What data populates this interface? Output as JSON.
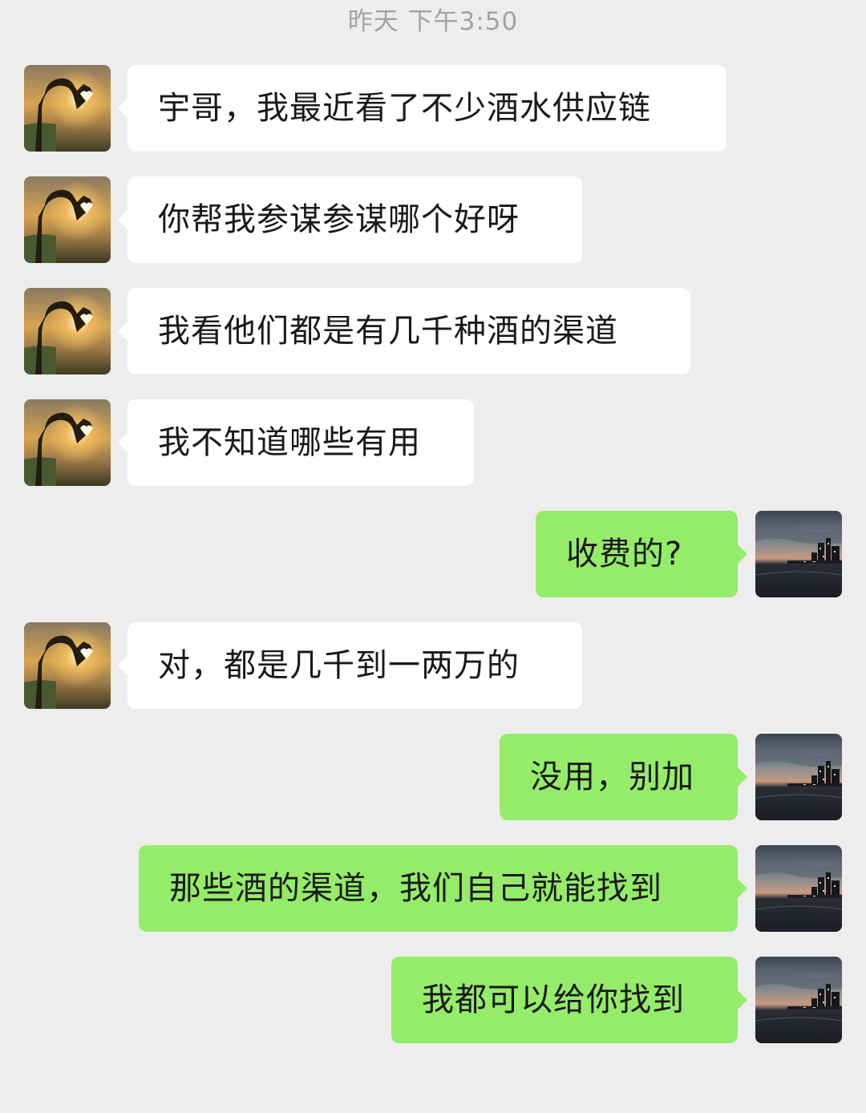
{
  "chat": {
    "timestamp": "昨天 下午3:50",
    "messages": [
      {
        "from": "contact",
        "text": "宇哥，我最近看了不少酒水供应链"
      },
      {
        "from": "contact",
        "text": "你帮我参谋参谋哪个好呀"
      },
      {
        "from": "contact",
        "text": "我看他们都是有几千种酒的渠道"
      },
      {
        "from": "contact",
        "text": "我不知道哪些有用"
      },
      {
        "from": "me",
        "text": "收费的?"
      },
      {
        "from": "contact",
        "text": "对，都是几千到一两万的"
      },
      {
        "from": "me",
        "text": "没用，别加"
      },
      {
        "from": "me",
        "text": "那些酒的渠道，我们自己就能找到"
      },
      {
        "from": "me",
        "text": "我都可以给你找到"
      }
    ]
  },
  "colors": {
    "background": "#ededed",
    "incoming_bubble": "#ffffff",
    "outgoing_bubble": "#95ec69",
    "timestamp_text": "#a3a3a3",
    "message_text": "#191919"
  },
  "avatars": {
    "contact": "sunset-heart-hands-avatar",
    "me": "city-skyline-at-dusk-avatar"
  }
}
